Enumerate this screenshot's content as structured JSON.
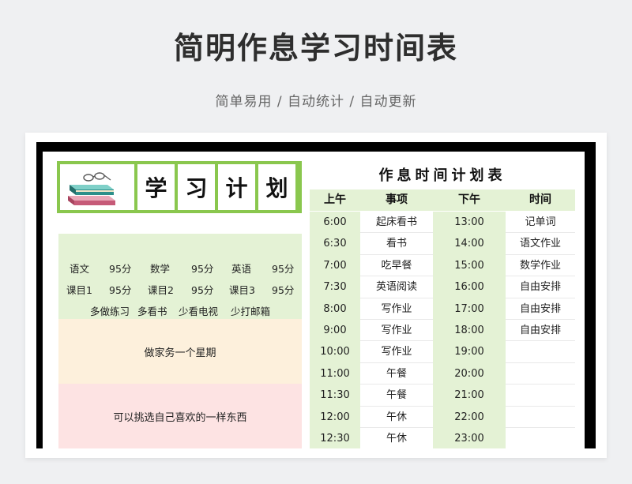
{
  "page": {
    "title": "简明作息学习时间表",
    "subtitle": "简单易用 / 自动统计 / 自动更新"
  },
  "plan_header": {
    "chars": [
      "学",
      "习",
      "计",
      "划"
    ],
    "image_icon": "books-and-glasses-icon"
  },
  "goals": {
    "row1": [
      "语文",
      "95分",
      "数学",
      "95分",
      "英语",
      "95分"
    ],
    "row2": [
      "课目1",
      "95分",
      "课目2",
      "95分",
      "课目3",
      "95分"
    ],
    "row3": [
      "多做练习",
      "多看书",
      "少看电视",
      "少打邮箱"
    ]
  },
  "chores": "做家务一个星期",
  "reward": "可以挑选自己喜欢的一样东西",
  "schedule": {
    "title": "作息时间计划表",
    "headers": [
      "上午",
      "事项",
      "下午",
      "时间"
    ],
    "rows": [
      {
        "am": "6:00",
        "am_item": "起床看书",
        "pm": "13:00",
        "pm_item": "记单词"
      },
      {
        "am": "6:30",
        "am_item": "看书",
        "pm": "14:00",
        "pm_item": "语文作业"
      },
      {
        "am": "7:00",
        "am_item": "吃早餐",
        "pm": "15:00",
        "pm_item": "数学作业"
      },
      {
        "am": "7:30",
        "am_item": "英语阅读",
        "pm": "16:00",
        "pm_item": "自由安排"
      },
      {
        "am": "8:00",
        "am_item": "写作业",
        "pm": "17:00",
        "pm_item": "自由安排"
      },
      {
        "am": "9:00",
        "am_item": "写作业",
        "pm": "18:00",
        "pm_item": "自由安排"
      },
      {
        "am": "10:00",
        "am_item": "写作业",
        "pm": "19:00",
        "pm_item": ""
      },
      {
        "am": "11:00",
        "am_item": "午餐",
        "pm": "20:00",
        "pm_item": ""
      },
      {
        "am": "11:30",
        "am_item": "午餐",
        "pm": "21:00",
        "pm_item": ""
      },
      {
        "am": "12:00",
        "am_item": "午休",
        "pm": "22:00",
        "pm_item": ""
      },
      {
        "am": "12:30",
        "am_item": "午休",
        "pm": "23:00",
        "pm_item": ""
      }
    ]
  },
  "colors": {
    "accent_green": "#8ac74e",
    "light_green": "#e4f2d5",
    "light_orange": "#fdf0dc",
    "light_pink": "#fde3e3"
  }
}
